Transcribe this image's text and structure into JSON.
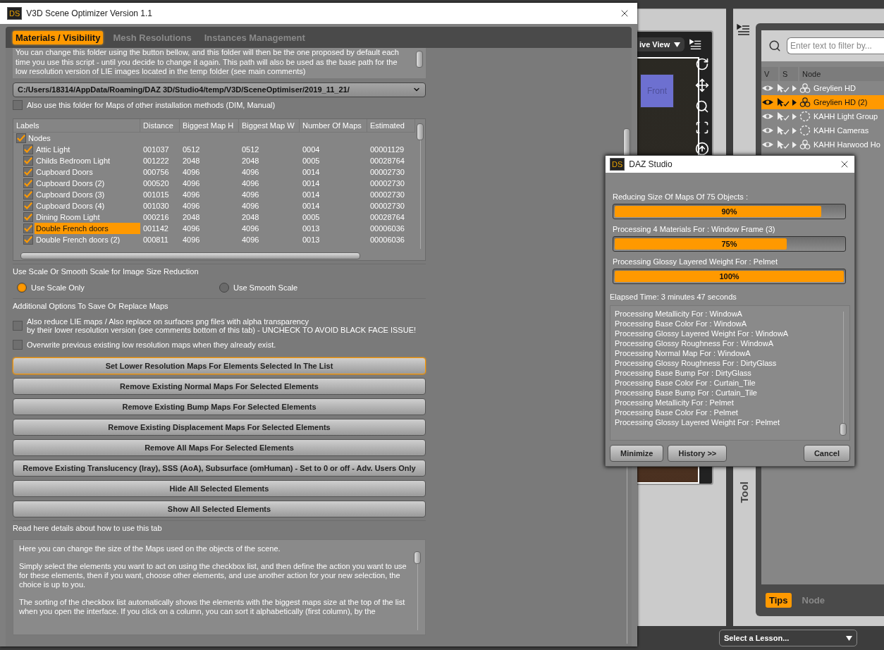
{
  "app": {
    "viewport": {
      "view_label": "ive View",
      "cube_label": "Front"
    },
    "scene": {
      "filter_placeholder": "Enter text to filter by...",
      "columns": [
        "V",
        "S",
        "Node"
      ],
      "nodes": [
        {
          "label": "Greylien HD",
          "selected": false,
          "kind": "figure"
        },
        {
          "label": "Greylien HD (2)",
          "selected": true,
          "kind": "figure"
        },
        {
          "label": "KAHH Light Group",
          "selected": false,
          "kind": "group"
        },
        {
          "label": "KAHH Cameras",
          "selected": false,
          "kind": "group"
        },
        {
          "label": "KAHH Harwood Ho",
          "selected": false,
          "kind": "figure"
        }
      ],
      "tabs": [
        {
          "label": "Tips",
          "selected": true
        },
        {
          "label": "Node",
          "selected": false
        }
      ]
    },
    "side_label": "Tool",
    "lesson": "Select a Lesson..."
  },
  "window": {
    "logo": "DS",
    "title": "V3D Scene Optimizer Version 1.1",
    "tabs": [
      {
        "label": "Materials / Visibility",
        "selected": true
      },
      {
        "label": "Mesh Resolutions",
        "selected": false
      },
      {
        "label": "Instances Management",
        "selected": false
      }
    ],
    "intro_lines": [
      "You can change this folder using the button bellow, and this folder will then be the one proposed by default each",
      "time you use this script - until you decide to change it again. This path will also be used as the base path for the",
      "low resolution version of LIE images located in the temp folder (see main comments)"
    ],
    "folder_path": "C:/Users/18314/AppData/Roaming/DAZ 3D/Studio4/temp/V3D/SceneOptimiser/2019_11_21/",
    "folder_option": {
      "label": "Also use this folder for Maps of other installation methods (DIM, Manual)",
      "checked": false
    },
    "table": {
      "columns": [
        "Labels",
        "Distance",
        "Biggest Map H",
        "Biggest Map W",
        "Number Of Maps",
        "Estimated"
      ],
      "group": {
        "label": "Nodes",
        "checked": true
      },
      "rows": [
        {
          "cells": [
            "Attic Light",
            "001037",
            "0512",
            "0512",
            "0004",
            "00001129"
          ],
          "checked": true,
          "selected": false
        },
        {
          "cells": [
            "Childs Bedroom Light",
            "001222",
            "2048",
            "2048",
            "0005",
            "00028764"
          ],
          "checked": true,
          "selected": false
        },
        {
          "cells": [
            "Cupboard Doors",
            "000756",
            "4096",
            "4096",
            "0014",
            "00002730"
          ],
          "checked": true,
          "selected": false
        },
        {
          "cells": [
            "Cupboard Doors (2)",
            "000520",
            "4096",
            "4096",
            "0014",
            "00002730"
          ],
          "checked": true,
          "selected": false
        },
        {
          "cells": [
            "Cupboard Doors (3)",
            "001015",
            "4096",
            "4096",
            "0014",
            "00002730"
          ],
          "checked": true,
          "selected": false
        },
        {
          "cells": [
            "Cupboard Doors (4)",
            "001030",
            "4096",
            "4096",
            "0014",
            "00002730"
          ],
          "checked": true,
          "selected": false
        },
        {
          "cells": [
            "Dining Room Light",
            "000216",
            "2048",
            "2048",
            "0005",
            "00028764"
          ],
          "checked": true,
          "selected": false
        },
        {
          "cells": [
            "Double French doors",
            "001142",
            "4096",
            "4096",
            "0013",
            "00006036"
          ],
          "checked": true,
          "selected": true
        },
        {
          "cells": [
            "Double French doors (2)",
            "000811",
            "4096",
            "4096",
            "0013",
            "00006036"
          ],
          "checked": true,
          "selected": false
        }
      ]
    },
    "scale_section": {
      "title": "Use Scale Or Smooth Scale for Image Size Reduction",
      "options": [
        {
          "label": "Use Scale Only",
          "selected": true
        },
        {
          "label": "Use Smooth Scale",
          "selected": false
        }
      ]
    },
    "options_section": {
      "title": "Additional Options To Save Or Replace Maps",
      "options": [
        {
          "lines": [
            "Also reduce LIE maps / Also replace on surfaces png files with alpha transparency",
            "by their lower resolution version (see comments bottom of this tab) - UNCHECK TO AVOID BLACK FACE ISSUE!"
          ],
          "checked": false
        },
        {
          "lines": [
            "Overwrite previous existing low resolution maps when they already exist."
          ],
          "checked": false
        }
      ]
    },
    "buttons": [
      {
        "label": "Set Lower Resolution Maps For Elements Selected In The List",
        "focused": true
      },
      {
        "label": "Remove Existing Normal Maps For Selected Elements",
        "focused": false
      },
      {
        "label": "Remove Existing Bump Maps For Selected Elements",
        "focused": false
      },
      {
        "label": "Remove Existing Displacement Maps For Selected Elements",
        "focused": false
      },
      {
        "label": "Remove All Maps For Selected Elements",
        "focused": false
      },
      {
        "label": "Remove Existing Translucency (Iray), SSS (AoA), Subsurface (omHuman) - Set to 0 or off - Adv. Users Only",
        "focused": false
      },
      {
        "label": "Hide All Selected Elements",
        "focused": false
      },
      {
        "label": "Show All Selected Elements",
        "focused": false
      }
    ],
    "help": {
      "title": "Read here details about how to use this tab",
      "paragraphs": [
        "Here you can change the size of the Maps used on the objects of the scene.",
        "Simply select the elements you want to act on using the checkbox list, and then define the action you want to use for these elements, then if you want, choose other elements, and use another action for your new selection, the choice is up to you.",
        "The sorting of the checkbox list automatically shows the elements with the biggest maps size at the top of the list when you open the interface. If you click on a column, you can sort it alphabetically (first column), by the"
      ]
    }
  },
  "dialog": {
    "logo": "DS",
    "title": "DAZ Studio",
    "progress": [
      {
        "label": "Reducing Size Of Maps Of 75 Objects :",
        "level": 0.9,
        "reading": "90%"
      },
      {
        "label": "Processing 4 Materials  For : Window Frame (3)",
        "level": 0.75,
        "reading": "75%"
      },
      {
        "label": "Processing Glossy Layered Weight For : Pelmet",
        "level": 1,
        "reading": "100%"
      }
    ],
    "elapsed": "Elapsed Time:  3 minutes 47 seconds",
    "log": [
      "Processing Metallicity For : WindowA",
      "Processing Base Color For : WindowA",
      "Processing Glossy Layered Weight For : WindowA",
      "Processing Glossy Roughness For : WindowA",
      "Processing Normal Map For : WindowA",
      "Processing Glossy Roughness For : DirtyGlass",
      "Processing Base Bump For : DirtyGlass",
      "Processing Base Color For : Curtain_Tile",
      "Processing Base Bump For : Curtain_Tile",
      "Processing Metallicity For : Pelmet",
      "Processing Base Color For : Pelmet",
      "Processing Glossy Layered Weight For : Pelmet"
    ],
    "buttons": [
      "Minimize",
      "History >>",
      "Cancel"
    ]
  }
}
